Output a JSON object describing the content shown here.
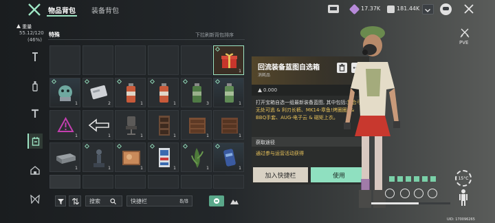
{
  "tabs": {
    "active": "物品背包",
    "other": "装备背包"
  },
  "currency": {
    "gems": "17.37K",
    "coins": "181.44K"
  },
  "weight": {
    "label": "重量",
    "value": "55.12/120",
    "percent": "(46%)"
  },
  "category": {
    "label": "特殊"
  },
  "pull_hint": "下拉刷新背包排序",
  "grid_counts": [
    "",
    "",
    "",
    "",
    "",
    "1",
    "1",
    "2",
    "1",
    "1",
    "3",
    "1",
    "1",
    "1",
    "1",
    "1",
    "1",
    "1",
    "1",
    "1",
    "1",
    "1",
    "1",
    "1"
  ],
  "detail": {
    "title": "回流装备蓝图自选箱",
    "subtitle": "消耗品",
    "weight": "0.000",
    "desc_plain": "打开宝箱自选一组最新装备蓝图, 其中包括:",
    "desc_hl": "复合弓-无处可逃 & 利刃长裤、MK14-章鱼!烤圈圈! & BBQ手套、AUG-电子云 & 磁矩上衣。",
    "source_label": "获取途径",
    "source_value": "通过参与运营活动获得",
    "add_quick_label": "加入快捷栏",
    "use_label": "使用"
  },
  "toolbar": {
    "search_label": "搜索",
    "quickbar_label": "快捷栏",
    "quickbar_count": "8/8"
  },
  "right": {
    "pve": "PVE",
    "temperature": "15°C"
  },
  "uid": "UID: 170096265",
  "colors": {
    "accent": "#9ee6c5",
    "highlight": "#e8c25a",
    "panel_btn": "#8fe0c0"
  }
}
